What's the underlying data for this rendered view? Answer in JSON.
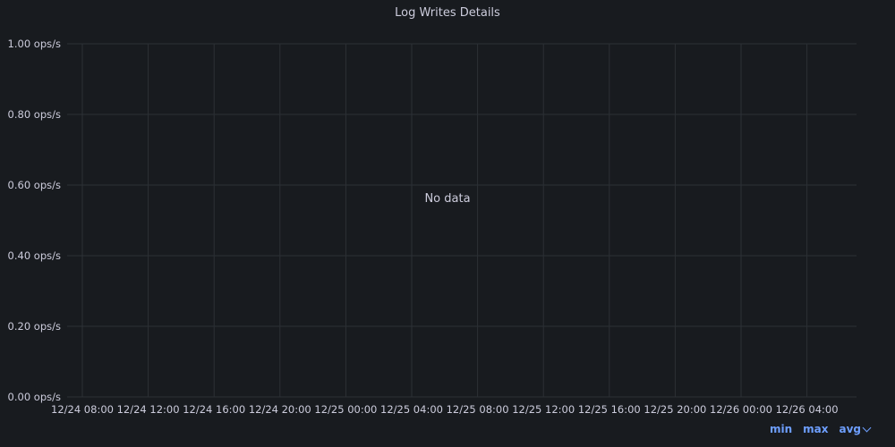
{
  "panel": {
    "title": "Log Writes Details",
    "no_data_text": "No data"
  },
  "legend": {
    "min_label": "min",
    "max_label": "max",
    "avg_label": "avg"
  },
  "chart_data": {
    "type": "line",
    "title": "Log Writes Details",
    "xlabel": "",
    "ylabel": "",
    "ylim": [
      0,
      1
    ],
    "y_ticks": [
      {
        "value": 1.0,
        "label": "1.00 ops/s"
      },
      {
        "value": 0.8,
        "label": "0.80 ops/s"
      },
      {
        "value": 0.6,
        "label": "0.60 ops/s"
      },
      {
        "value": 0.4,
        "label": "0.40 ops/s"
      },
      {
        "value": 0.2,
        "label": "0.20 ops/s"
      },
      {
        "value": 0.0,
        "label": "0.00 ops/s"
      }
    ],
    "x_ticks": [
      "12/24 08:00",
      "12/24 12:00",
      "12/24 16:00",
      "12/24 20:00",
      "12/25 00:00",
      "12/25 04:00",
      "12/25 08:00",
      "12/25 12:00",
      "12/25 16:00",
      "12/25 20:00",
      "12/26 00:00",
      "12/26 04:00"
    ],
    "series": [],
    "grid": true,
    "colors": {
      "background": "#181b1f",
      "grid": "#2c3035",
      "text": "#ccccdc",
      "link": "#6e9fff"
    }
  }
}
